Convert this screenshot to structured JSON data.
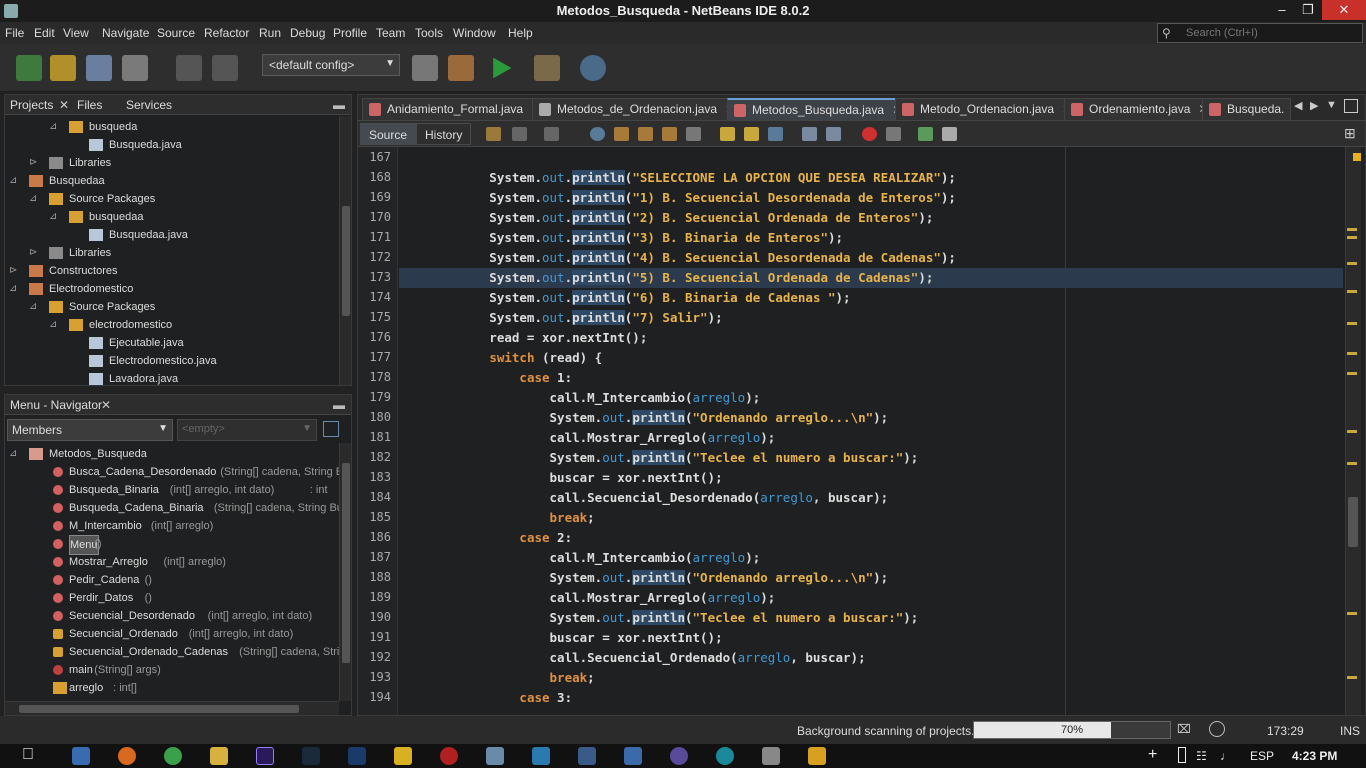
{
  "window": {
    "title": "Metodos_Busqueda - NetBeans IDE 8.0.2",
    "minimize": "–",
    "maximize": "❐",
    "close": "✕"
  },
  "menu": [
    "File",
    "Edit",
    "View",
    "Navigate",
    "Source",
    "Refactor",
    "Run",
    "Debug",
    "Profile",
    "Team",
    "Tools",
    "Window",
    "Help"
  ],
  "search": {
    "placeholder": "Search (Ctrl+I)"
  },
  "toolbar": {
    "config": "<default config>"
  },
  "projects_panel": {
    "tabs": [
      "Projects",
      "Files",
      "Services"
    ],
    "rows": [
      {
        "label": "busqueda",
        "indent": 2,
        "icon": "package"
      },
      {
        "label": "Busqueda.java",
        "indent": 3,
        "icon": "java-file"
      },
      {
        "label": "Libraries",
        "indent": 1,
        "icon": "libraries"
      },
      {
        "label": "Busquedaa",
        "indent": 0,
        "icon": "project"
      },
      {
        "label": "Source Packages",
        "indent": 1,
        "icon": "source-packages"
      },
      {
        "label": "busquedaa",
        "indent": 2,
        "icon": "package"
      },
      {
        "label": "Busquedaa.java",
        "indent": 3,
        "icon": "java-file"
      },
      {
        "label": "Libraries",
        "indent": 1,
        "icon": "libraries"
      },
      {
        "label": "Constructores",
        "indent": 0,
        "icon": "project"
      },
      {
        "label": "Electrodomestico",
        "indent": 0,
        "icon": "project"
      },
      {
        "label": "Source Packages",
        "indent": 1,
        "icon": "source-packages"
      },
      {
        "label": "electrodomestico",
        "indent": 2,
        "icon": "package"
      },
      {
        "label": "Ejecutable.java",
        "indent": 3,
        "icon": "java-file"
      },
      {
        "label": "Electrodomestico.java",
        "indent": 3,
        "icon": "java-file"
      },
      {
        "label": "Lavadora.java",
        "indent": 3,
        "icon": "java-file"
      }
    ]
  },
  "navigator_panel": {
    "title": "Menu - Navigator",
    "members_select": "Members",
    "empty_select": "<empty>",
    "root": "Metodos_Busqueda",
    "members": [
      {
        "name": "Busca_Cadena_Desordenado",
        "params": "(String[] cadena, String E",
        "ret": ""
      },
      {
        "name": "Busqueda_Binaria",
        "params": "(int[] arreglo, int dato)",
        "ret": " : int"
      },
      {
        "name": "Busqueda_Cadena_Binaria",
        "params": "(String[] cadena, String Bus",
        "ret": ""
      },
      {
        "name": "M_Intercambio",
        "params": "(int[] arreglo)",
        "ret": ""
      },
      {
        "name": "Menu",
        "params": "()",
        "ret": ""
      },
      {
        "name": "Mostrar_Arreglo",
        "params": "(int[] arreglo)",
        "ret": ""
      },
      {
        "name": "Pedir_Cadena",
        "params": "()",
        "ret": ""
      },
      {
        "name": "Perdir_Datos",
        "params": "()",
        "ret": ""
      },
      {
        "name": "Secuencial_Desordenado",
        "params": "(int[] arreglo, int dato)",
        "ret": ""
      },
      {
        "name": "Secuencial_Ordenado",
        "params": "(int[] arreglo, int dato)",
        "ret": ""
      },
      {
        "name": "Secuencial_Ordenado_Cadenas",
        "params": "(String[] cadena, String",
        "ret": ""
      },
      {
        "name": "main",
        "params": "(String[] args)",
        "ret": ""
      },
      {
        "name": "arreglo",
        "params": "",
        "ret": " : int[]"
      }
    ]
  },
  "editor": {
    "tabs": [
      "Anidamiento_Formal.java",
      "Metodos_de_Ordenacion.java",
      "Metodos_Busqueda.java",
      "Metodo_Ordenacion.java",
      "Ordenamiento.java",
      "Busqueda."
    ],
    "active_tab": 2,
    "source_btn": "Source",
    "history_btn": "History",
    "first_line": 167,
    "lines": [
      "",
      "            System.out.println(\"SELECCIONE LA OPCION QUE DESEA REALIZAR\");",
      "            System.out.println(\"1) B. Secuencial Desordenada de Enteros\");",
      "            System.out.println(\"2) B. Secuencial Ordenada de Enteros\");",
      "            System.out.println(\"3) B. Binaria de Enteros\");",
      "            System.out.println(\"4) B. Secuencial Desordenada de Cadenas\");",
      "            System.out.println(\"5) B. Secuencial Ordenada de Cadenas\");",
      "            System.out.println(\"6) B. Binaria de Cadenas \");",
      "            System.out.println(\"7) Salir\");",
      "            read = xor.nextInt();",
      "            switch (read) {",
      "                case 1:",
      "                    call.M_Intercambio(arreglo);",
      "                    System.out.println(\"Ordenando arreglo...\\n\");",
      "                    call.Mostrar_Arreglo(arreglo);",
      "                    System.out.println(\"Teclee el numero a buscar:\");",
      "                    buscar = xor.nextInt();",
      "                    call.Secuencial_Desordenado(arreglo, buscar);",
      "                    break;",
      "                case 2:",
      "                    call.M_Intercambio(arreglo);",
      "                    System.out.println(\"Ordenando arreglo...\\n\");",
      "                    call.Mostrar_Arreglo(arreglo);",
      "                    System.out.println(\"Teclee el numero a buscar:\");",
      "                    buscar = xor.nextInt();",
      "                    call.Secuencial_Ordenado(arreglo, buscar);",
      "                    break;",
      "                case 3:"
    ],
    "current_line": 173
  },
  "status": {
    "task": "Background scanning of projects...",
    "progress_text": "70%",
    "progress": 0.7,
    "position": "173:29",
    "mode": "INS"
  },
  "taskbar": {
    "lang": "ESP",
    "time": "4:23 PM"
  }
}
